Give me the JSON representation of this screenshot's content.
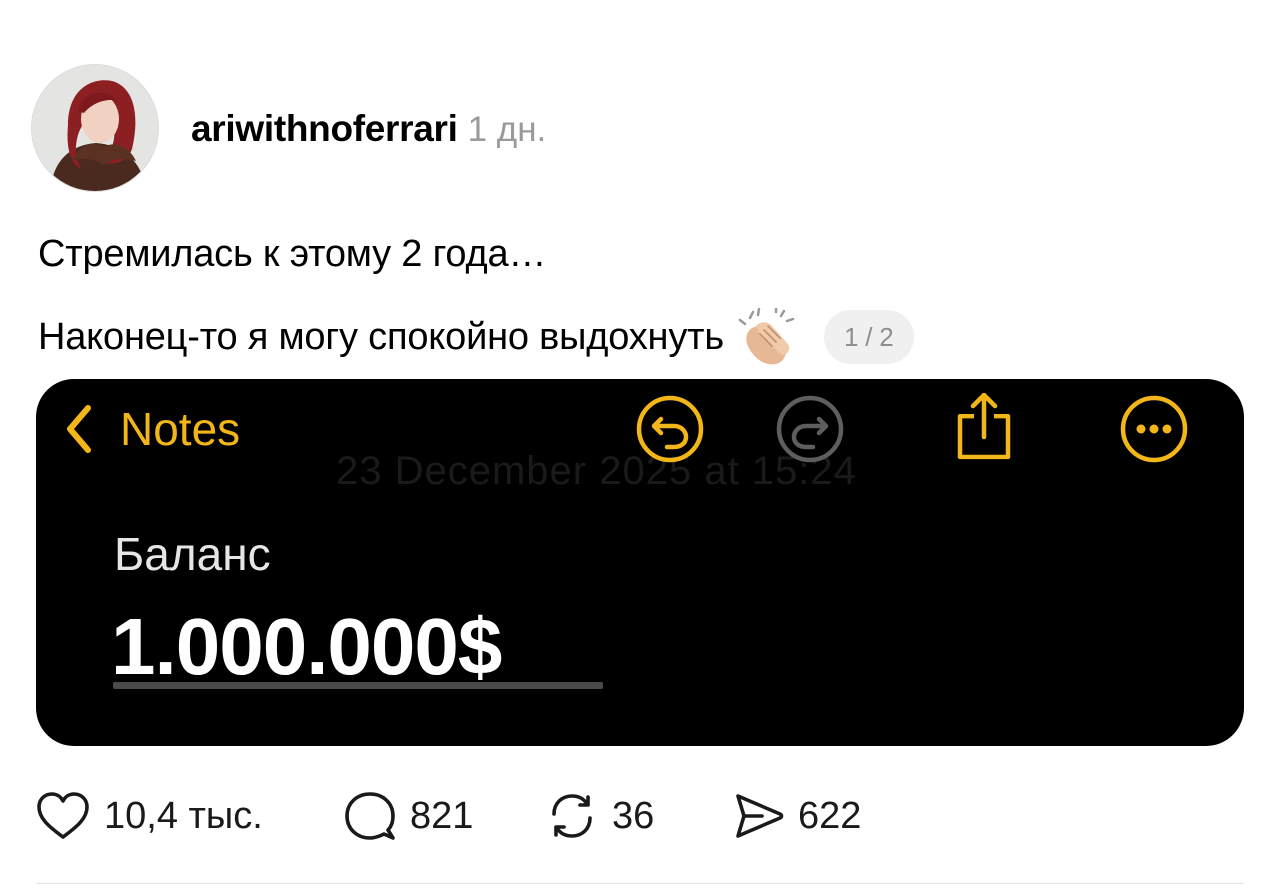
{
  "post": {
    "author": {
      "username": "ariwithnoferrari",
      "time": "1 дн."
    },
    "caption": {
      "line1": "Стремилась к этому 2 года…",
      "line2": "Наконец-то я могу спокойно выдохнуть",
      "emoji": "clapping-hands-icon"
    },
    "page_indicator": "1 / 2"
  },
  "media": {
    "toolbar": {
      "back_label": "Notes",
      "icons": [
        "undo-icon",
        "redo-icon",
        "share-icon",
        "more-icon"
      ],
      "accent_color": "#f2b619"
    },
    "ghost_date": "23 December 2025 at 15:24",
    "balance_label": "Баланс",
    "balance_value": "1.000.000$"
  },
  "actions": {
    "likes": "10,4 тыс.",
    "comments": "821",
    "reposts": "36",
    "shares": "622"
  }
}
